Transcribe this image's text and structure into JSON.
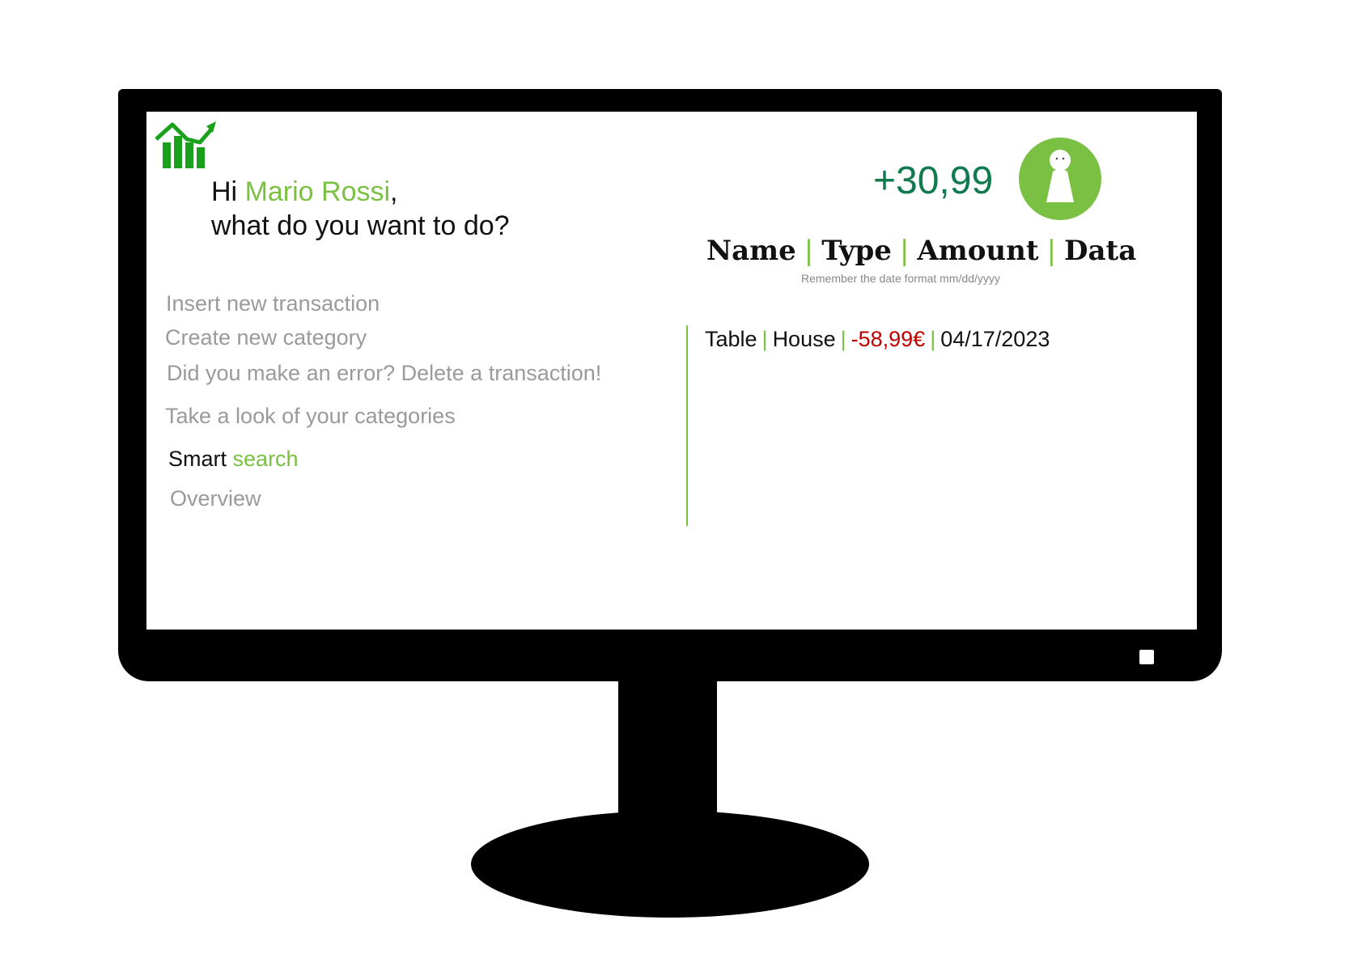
{
  "header": {
    "greeting_prefix": "Hi ",
    "user_name": "Mario Rossi",
    "greeting_suffix": ",",
    "prompt": "what do you want to do?"
  },
  "balance": "+30,99",
  "menu": {
    "insert_transaction": "Insert new transaction",
    "create_category": "Create new category",
    "delete_transaction": "Did you make an error? Delete a transaction!",
    "view_categories": "Take a look of your categories",
    "smart_search_prefix": "Smart",
    "smart_search_accent": "search",
    "overview": "Overview"
  },
  "table": {
    "columns": [
      "Name",
      "Type",
      "Amount",
      "Data"
    ],
    "separator": "|",
    "hint": "Remember the date format mm/dd/yyyy",
    "rows": [
      {
        "name": "Table",
        "type": "House",
        "amount": "-58,99€",
        "date": "04/17/2023"
      }
    ]
  },
  "colors": {
    "accent_green": "#7ac143",
    "balance_green": "#0f7a4e",
    "negative_red": "#c00000",
    "muted_gray": "#9a9a9a",
    "logo_green": "#1aa01a"
  },
  "icons": {
    "logo": "growth-chart-icon",
    "avatar": "user-avatar-icon"
  }
}
